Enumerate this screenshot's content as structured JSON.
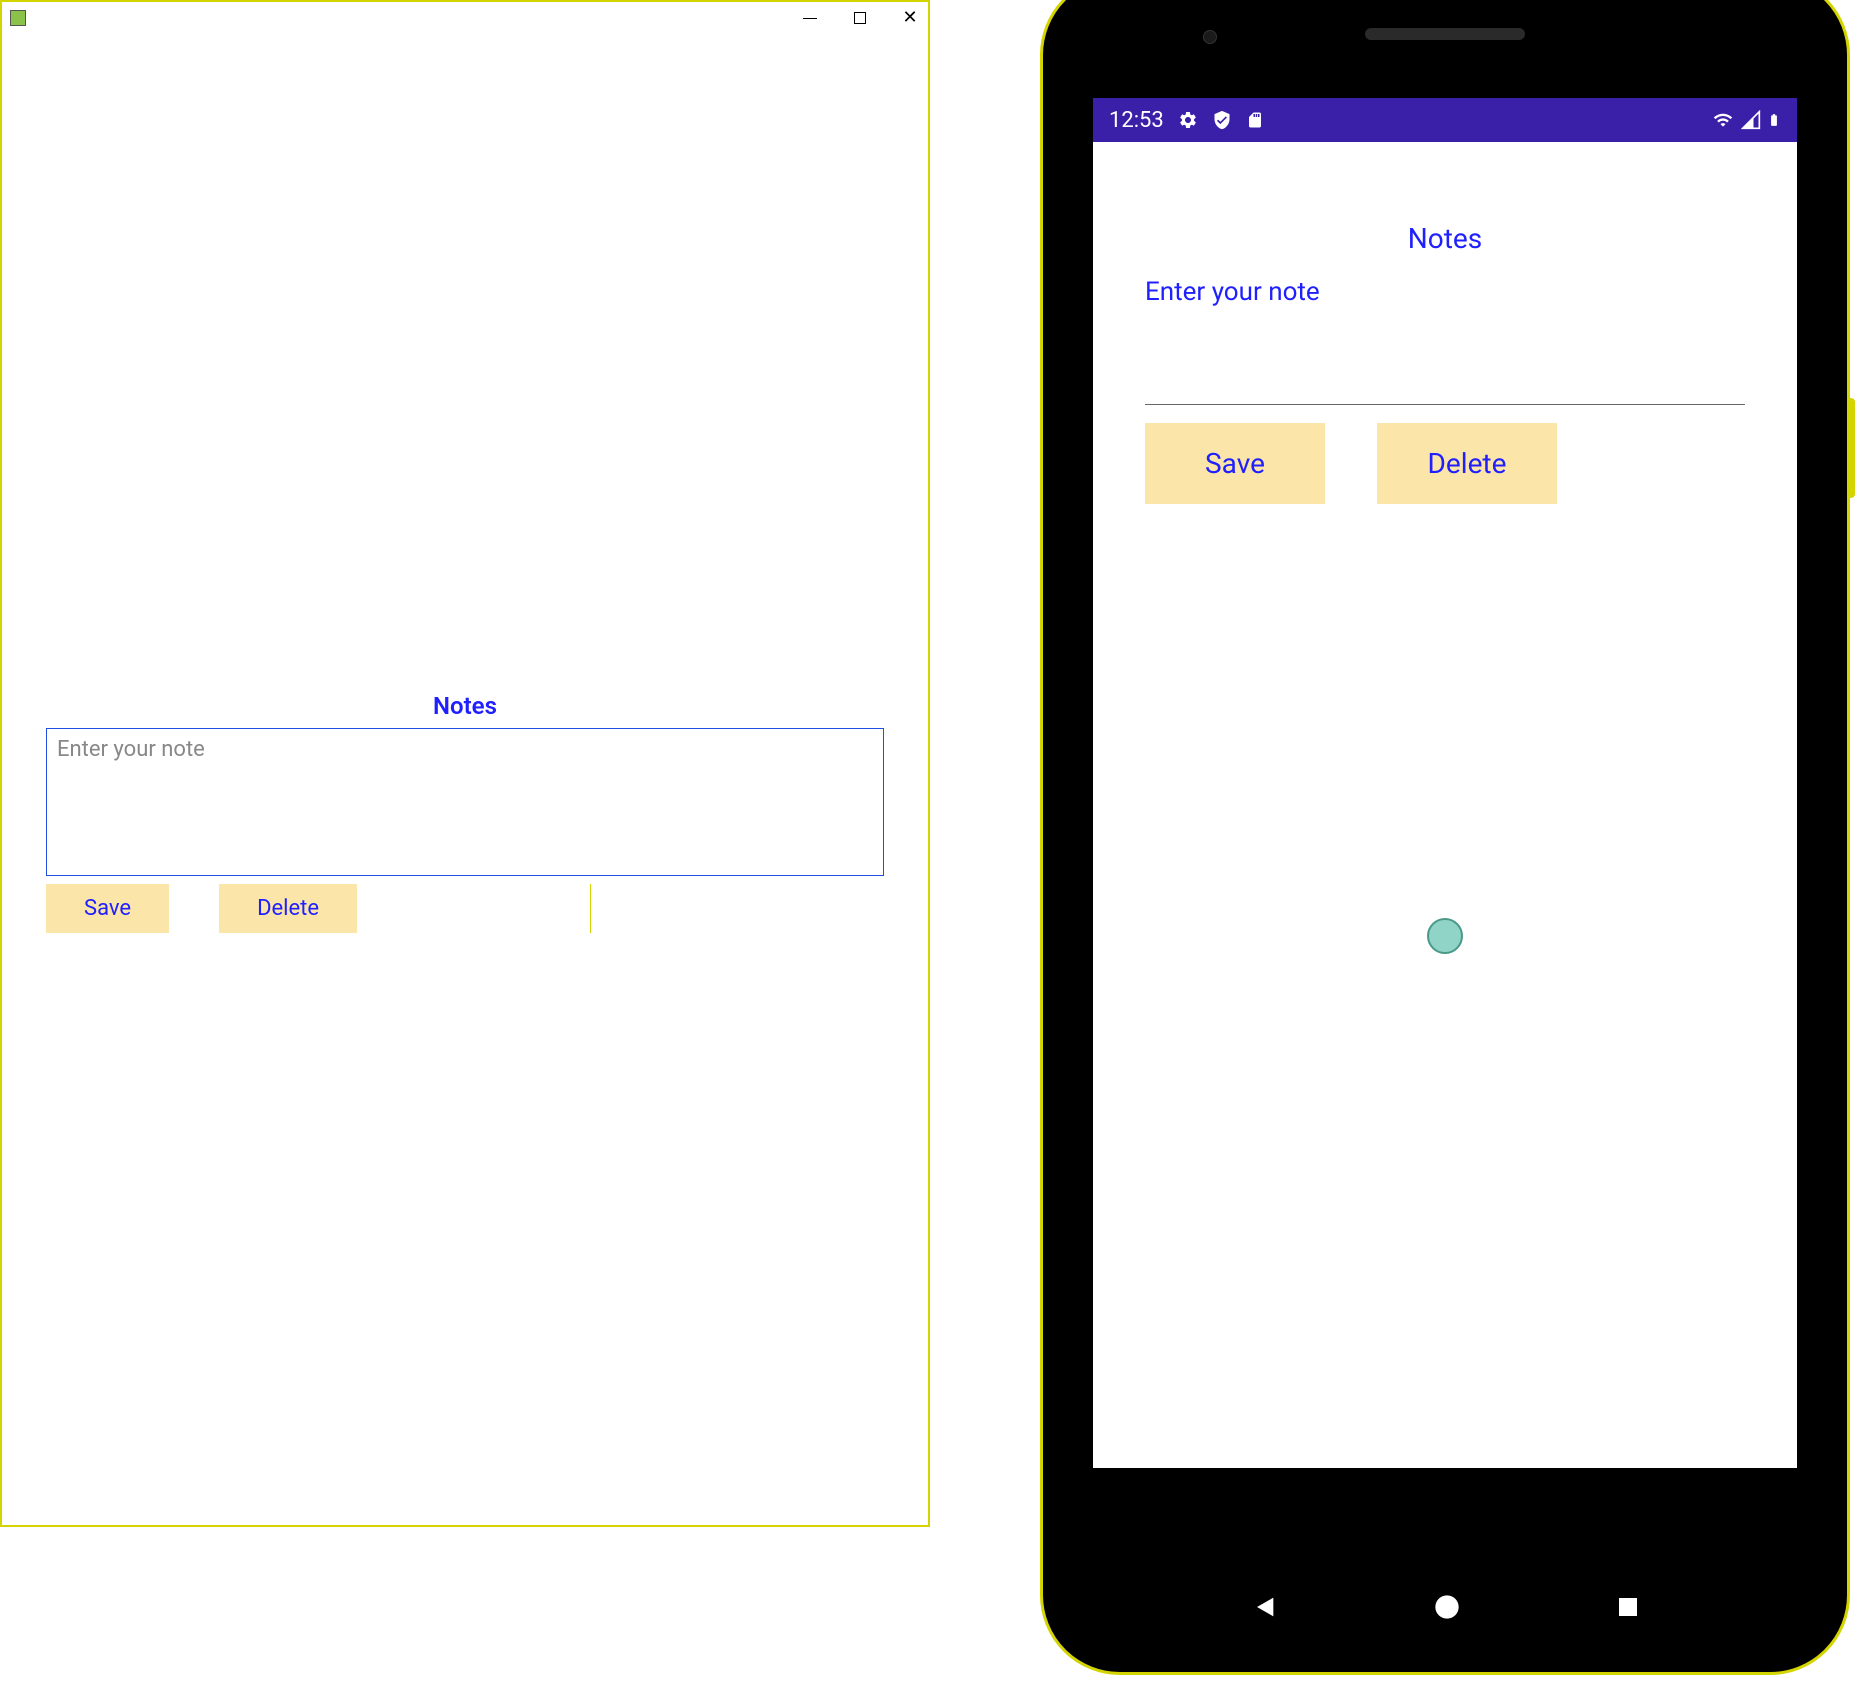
{
  "desktop": {
    "title": "Notes",
    "input_placeholder": "Enter your note",
    "save_label": "Save",
    "delete_label": "Delete"
  },
  "phone": {
    "statusbar": {
      "time": "12:53"
    },
    "title": "Notes",
    "input_placeholder": "Enter your note",
    "save_label": "Save",
    "delete_label": "Delete"
  }
}
